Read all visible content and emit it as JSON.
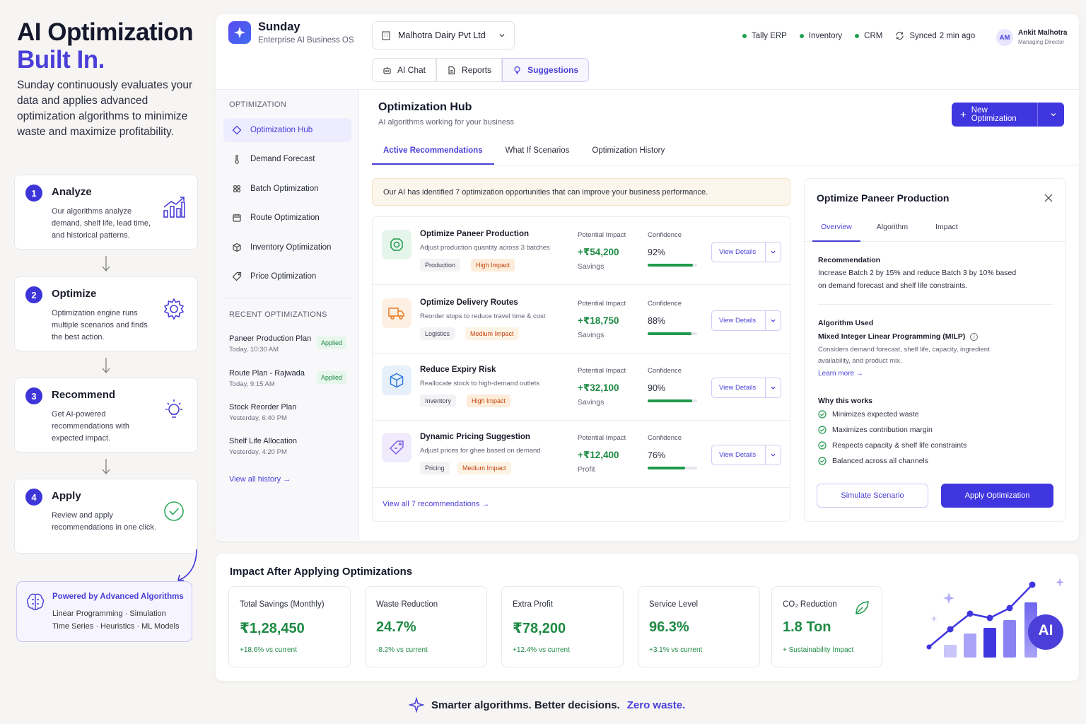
{
  "hero": {
    "title_line1": "AI Optimization",
    "title_line2": "Built In.",
    "description": "Sunday continuously evaluates your data and applies advanced optimization algorithms to minimize waste and maximize profitability."
  },
  "steps": [
    {
      "num": "1",
      "title": "Analyze",
      "desc": "Our algorithms analyze demand, shelf life, lead time, and historical patterns.",
      "icon": "chart-icon"
    },
    {
      "num": "2",
      "title": "Optimize",
      "desc": "Optimization engine runs multiple scenarios and finds the best action.",
      "icon": "gear-icon"
    },
    {
      "num": "3",
      "title": "Recommend",
      "desc": "Get AI-powered recommendations with expected impact.",
      "icon": "lightbulb-icon"
    },
    {
      "num": "4",
      "title": "Apply",
      "desc": "Review and apply recommendations in one click.",
      "icon": "check-circle-icon"
    }
  ],
  "powered": {
    "title": "Powered by Advanced Algorithms",
    "line1": "Linear Programming · Simulation",
    "line2": "Time Series · Heuristics · ML Models"
  },
  "app": {
    "brand": "Sunday",
    "brand_sub": "Enterprise AI Business OS",
    "company": "Malhotra Dairy Pvt Ltd",
    "integrations": [
      "Tally ERP",
      "Inventory",
      "CRM"
    ],
    "sync_label": "Synced",
    "sync_time": "2 min ago",
    "user": {
      "initials": "AM",
      "name": "Ankit Malhotra",
      "role": "Managing Director"
    },
    "topnav": [
      "AI Chat",
      "Reports",
      "Suggestions"
    ]
  },
  "sidebar": {
    "heading": "OPTIMIZATION",
    "items": [
      "Optimization Hub",
      "Demand Forecast",
      "Batch Optimization",
      "Route Optimization",
      "Inventory Optimization",
      "Price Optimization"
    ],
    "recent_heading": "RECENT OPTIMIZATIONS",
    "recent": [
      {
        "name": "Paneer Production Plan",
        "time": "Today, 10:30 AM",
        "badge": "Applied"
      },
      {
        "name": "Route Plan - Rajwada",
        "time": "Today, 9:15 AM",
        "badge": "Applied"
      },
      {
        "name": "Stock Reorder Plan",
        "time": "Yesterday, 6:40 PM",
        "badge": ""
      },
      {
        "name": "Shelf Life Allocation",
        "time": "Yesterday, 4:20 PM",
        "badge": ""
      }
    ],
    "view_history": "View all history"
  },
  "main": {
    "title": "Optimization Hub",
    "subtitle": "AI algorithms working for your business",
    "new_button": "New Optimization",
    "tabs": [
      "Active Recommendations",
      "What If Scenarios",
      "Optimization History"
    ],
    "banner": "Our AI has identified 7 optimization opportunities that can improve your business performance.",
    "impact_label": "Potential Impact",
    "confidence_label": "Confidence",
    "view_details": "View Details",
    "recommendations": [
      {
        "title": "Optimize Paneer Production",
        "desc": "Adjust production quantity across 3 batches",
        "tag": "Production",
        "impact_tag": "High Impact",
        "value": "+₹54,200",
        "value_label": "Savings",
        "confidence": "92%",
        "confidence_frac": 0.92,
        "icon": "camera-box-icon",
        "color": "#1f9a4b"
      },
      {
        "title": "Optimize Delivery Routes",
        "desc": "Reorder stops to reduce travel time & cost",
        "tag": "Logistics",
        "impact_tag": "Medium Impact",
        "value": "+₹18,750",
        "value_label": "Savings",
        "confidence": "88%",
        "confidence_frac": 0.88,
        "icon": "truck-icon",
        "color": "#ea7a22"
      },
      {
        "title": "Reduce Expiry Risk",
        "desc": "Reallocate stock to high-demand outlets",
        "tag": "Inventory",
        "impact_tag": "High Impact",
        "value": "+₹32,100",
        "value_label": "Savings",
        "confidence": "90%",
        "confidence_frac": 0.9,
        "icon": "cube-icon",
        "color": "#2f7ad8"
      },
      {
        "title": "Dynamic Pricing Suggestion",
        "desc": "Adjust prices for ghee based on demand",
        "tag": "Pricing",
        "impact_tag": "Medium Impact",
        "value": "+₹12,400",
        "value_label": "Profit",
        "confidence": "76%",
        "confidence_frac": 0.76,
        "icon": "price-tag-icon",
        "color": "#7b5ce0"
      }
    ],
    "view_all": "View all 7 recommendations"
  },
  "panel": {
    "title": "Optimize Paneer Production",
    "tabs": [
      "Overview",
      "Algorithm",
      "Impact"
    ],
    "rec_heading": "Recommendation",
    "rec_text": "Increase Batch 2 by 15% and reduce Batch 3 by 10% based on demand forecast and shelf life constraints.",
    "algo_heading": "Algorithm Used",
    "algo_name": "Mixed Integer Linear Programming (MILP)",
    "algo_desc": "Considers demand forecast, shelf life, capacity, ingredient availability, and product mix.",
    "learn_more": "Learn more",
    "why_heading": "Why this works",
    "why": [
      "Minimizes expected waste",
      "Maximizes contribution margin",
      "Respects capacity & shelf life constraints",
      "Balanced across all channels"
    ],
    "simulate": "Simulate Scenario",
    "apply": "Apply Optimization"
  },
  "impact": {
    "title": "Impact After Applying Optimizations",
    "metrics": [
      {
        "label": "Total Savings (Monthly)",
        "value": "₹1,28,450",
        "delta": "+18.6% vs current"
      },
      {
        "label": "Waste Reduction",
        "value": "24.7%",
        "delta": "-8.2% vs current"
      },
      {
        "label": "Extra Profit",
        "value": "₹78,200",
        "delta": "+12.4% vs current"
      },
      {
        "label": "Service Level",
        "value": "96.3%",
        "delta": "+3.1% vs current"
      },
      {
        "label": "CO₂ Reduction",
        "value": "1.8 Ton",
        "delta": "+ Sustainability Impact"
      }
    ],
    "ai_badge": "AI"
  },
  "tagline": {
    "part1": "Smarter algorithms. Better decisions.",
    "part2": "Zero waste."
  },
  "colors": {
    "accent": "#4a3fd8",
    "positive": "#1f8a44",
    "high_impact_bg": "#fdecd9",
    "high_impact_fg": "#c2410c"
  }
}
